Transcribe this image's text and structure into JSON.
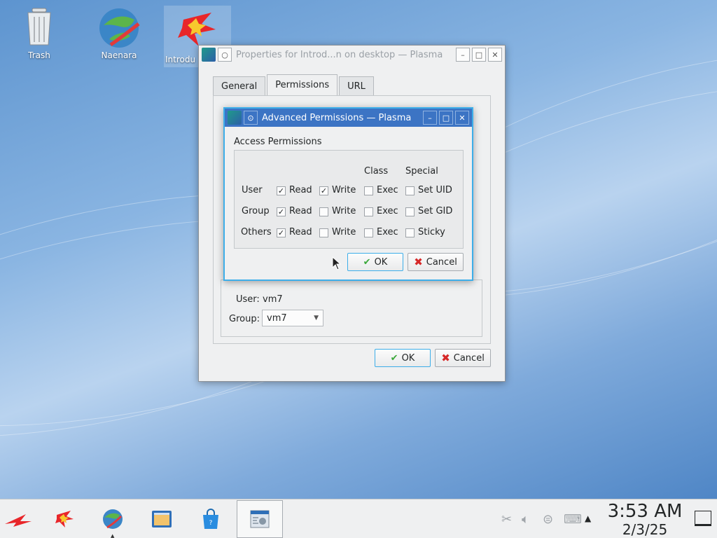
{
  "desktop": {
    "icons": [
      {
        "label": "Trash",
        "icon": "trash-icon"
      },
      {
        "label": "Naenara",
        "icon": "globe-icon"
      },
      {
        "label": "Introdu",
        "icon": "red-star-icon"
      }
    ]
  },
  "properties_dialog": {
    "title": "Properties for Introd...n on desktop — Plasma",
    "tabs": [
      "General",
      "Permissions",
      "URL"
    ],
    "active_tab": "Permissions",
    "ownership": {
      "user_label": "User:",
      "user_value": "vm7",
      "group_label": "Group:",
      "group_value": "vm7"
    },
    "ok_label": "OK",
    "cancel_label": "Cancel"
  },
  "advanced_dialog": {
    "title": "Advanced Permissions — Plasma",
    "section_label": "Access Permissions",
    "col_class": "Class",
    "col_special": "Special",
    "rows": [
      {
        "who": "User",
        "read": "Read",
        "read_checked": true,
        "write": "Write",
        "write_checked": true,
        "exec": "Exec",
        "exec_checked": false,
        "special": "Set UID",
        "special_checked": false
      },
      {
        "who": "Group",
        "read": "Read",
        "read_checked": true,
        "write": "Write",
        "write_checked": false,
        "exec": "Exec",
        "exec_checked": false,
        "special": "Set GID",
        "special_checked": false
      },
      {
        "who": "Others",
        "read": "Read",
        "read_checked": true,
        "write": "Write",
        "write_checked": false,
        "exec": "Exec",
        "exec_checked": false,
        "special": "Sticky",
        "special_checked": false
      }
    ],
    "ok_label": "OK",
    "cancel_label": "Cancel"
  },
  "taskbar": {
    "clock_time": "3:53 AM",
    "clock_date": "2/3/25",
    "items": [
      "red-star-menu-icon",
      "red-star-app-icon",
      "globe-icon",
      "file-manager-icon",
      "shopping-bag-icon",
      "settings-window-icon"
    ],
    "tray": [
      "scissors-icon",
      "volume-icon",
      "network-icon",
      "display-icon",
      "expand-arrow-icon"
    ]
  },
  "colors": {
    "accent": "#3daee9",
    "active_titlebar": "#3c74c4",
    "ok_check": "#3aa83a",
    "cancel_x": "#d62828"
  }
}
